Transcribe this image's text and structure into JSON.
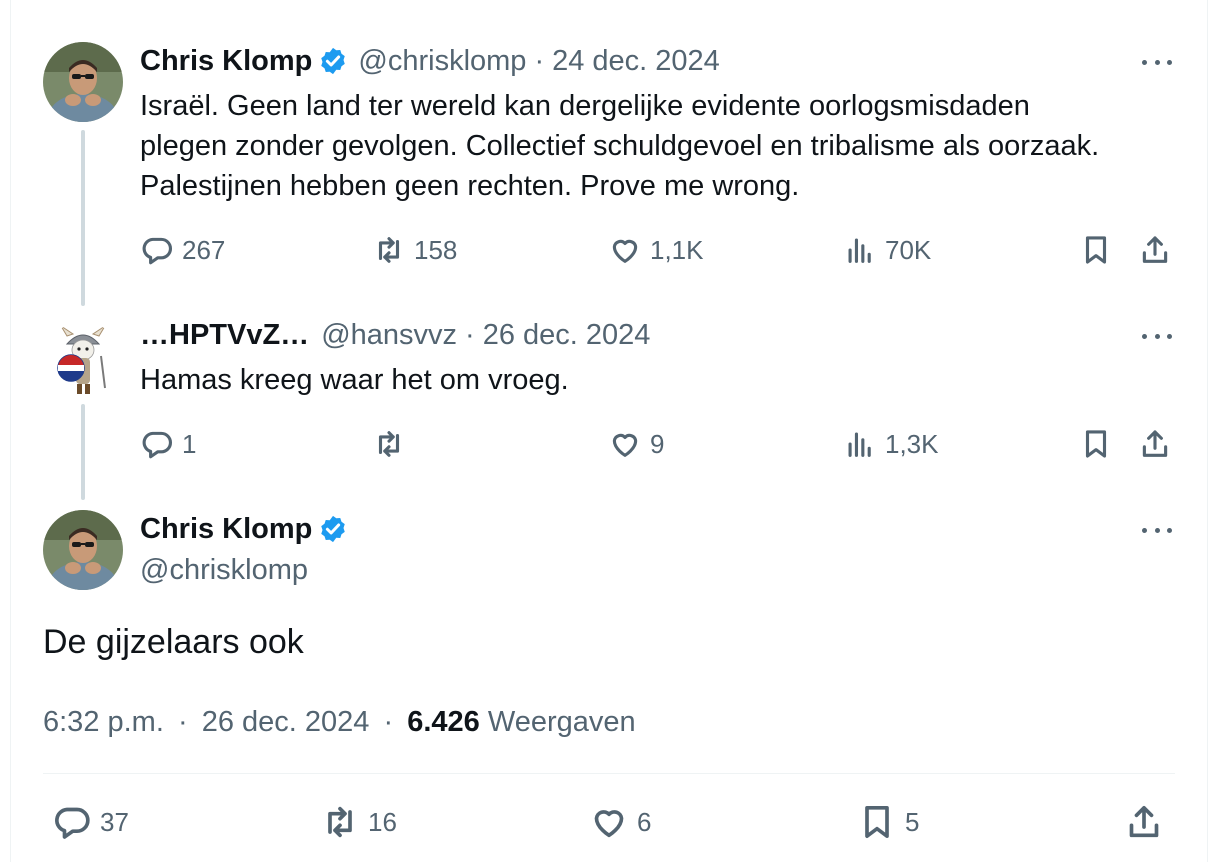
{
  "thread": [
    {
      "author": "Chris Klomp",
      "verified": true,
      "handle": "@chrisklomp",
      "separator": "·",
      "date": "24 dec. 2024",
      "text_lines": [
        "Israël. Geen land ter wereld kan dergelijke evidente oorlogsmisdaden",
        "plegen zonder gevolgen. Collectief schuldgevoel en tribalisme als oorzaak.",
        "Palestijnen hebben geen rechten. Prove me wrong."
      ],
      "replies": "267",
      "reposts": "158",
      "likes": "1,1K",
      "views": "70K"
    },
    {
      "author": "…HPTVvZ…",
      "verified": false,
      "handle": "@hansvvz",
      "separator": "·",
      "date": "26 dec. 2024",
      "text_lines": [
        "Hamas kreeg waar het om vroeg."
      ],
      "replies": "1",
      "reposts": "",
      "likes": "9",
      "views": "1,3K"
    }
  ],
  "main_tweet": {
    "author": "Chris Klomp",
    "verified": true,
    "handle": "@chrisklomp",
    "text": "De gijzelaars ook",
    "time": "6:32 p.m.",
    "separator": "·",
    "date": "26 dec. 2024",
    "views_count": "6.426",
    "views_label": "Weergaven",
    "replies": "37",
    "reposts": "16",
    "likes": "6",
    "bookmarks": "5"
  },
  "icons": {
    "verified": "verified-badge-icon",
    "reply": "reply-icon",
    "repost": "repost-icon",
    "like": "heart-icon",
    "views": "views-icon",
    "bookmark": "bookmark-icon",
    "share": "share-icon",
    "more": "more-icon"
  },
  "colors": {
    "verified_blue": "#1d9bf0",
    "muted_text": "#536471",
    "primary_text": "#0f1419",
    "thread_line": "#cfd9de"
  }
}
